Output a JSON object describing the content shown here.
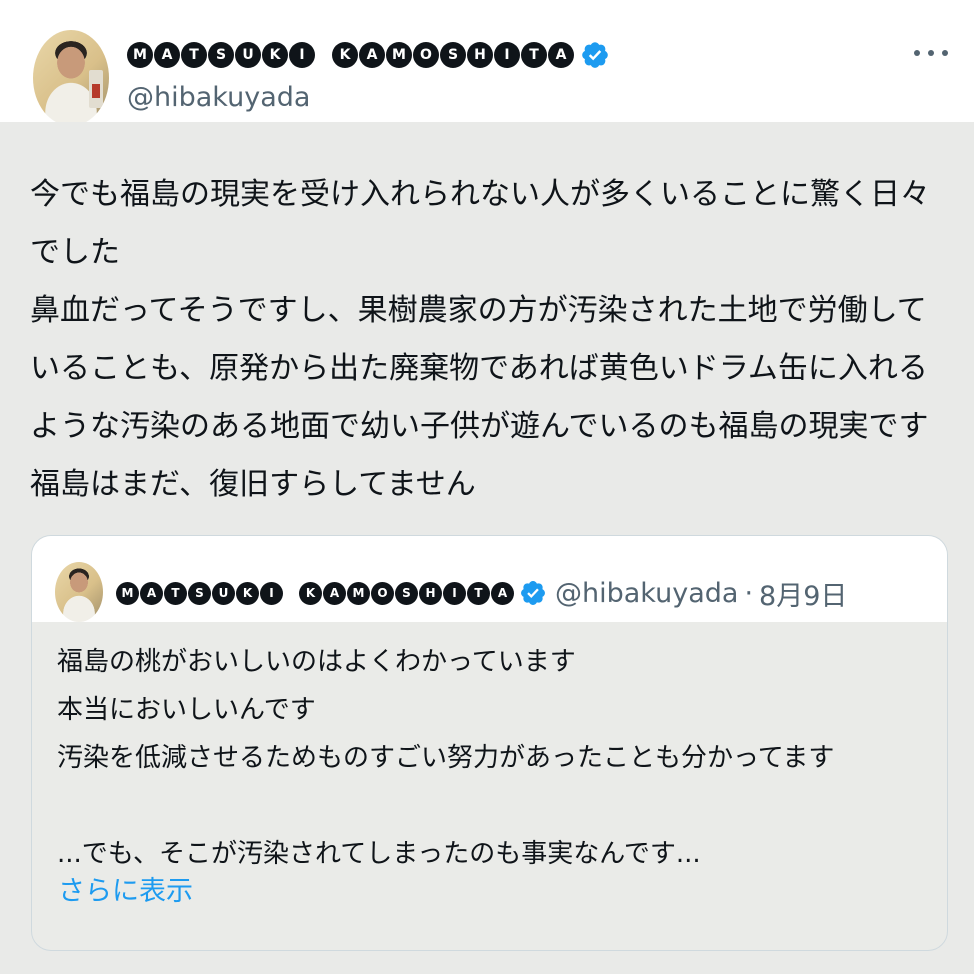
{
  "tweet": {
    "author": {
      "display_name_letters": [
        "M",
        "A",
        "T",
        "S",
        "U",
        "K",
        "I",
        "",
        "K",
        "A",
        "M",
        "O",
        "S",
        "H",
        "I",
        "T",
        "A"
      ],
      "handle": "@hibakuyada",
      "avatar_icon": "profile-photo",
      "verified_icon": "verified-badge-icon"
    },
    "more_icon": "more-options-icon",
    "text_lines": [
      "今でも福島の現実を受け入れられない人が多くいることに驚く日々",
      "でした",
      "鼻血だってそうですし、果樹農家の方が汚染された土地で労働して",
      "いることも、原発から出た廃棄物であれば黄色いドラム缶に入れる",
      "ような汚染のある地面で幼い子供が遊んでいるのも福島の現実です",
      "福島はまだ、復旧すらしてません"
    ]
  },
  "quote": {
    "author": {
      "display_name_letters": [
        "M",
        "A",
        "T",
        "S",
        "U",
        "K",
        "I",
        "",
        "K",
        "A",
        "M",
        "O",
        "S",
        "H",
        "I",
        "T",
        "A"
      ],
      "handle": "@hibakuyada",
      "separator": "·",
      "date": "8月9日"
    },
    "text_lines": [
      "福島の桃がおいしいのはよくわかっています",
      "本当においしいんです",
      "汚染を低減させるためものすごい努力があったことも分かってます",
      "",
      "...でも、そこが汚染されてしまったのも事実なんです..."
    ],
    "show_more": "さらに表示"
  },
  "colors": {
    "text": "#0f1419",
    "secondary": "#536471",
    "link": "#1d9bf0",
    "verified": "#1d9bf0",
    "content_bg": "#e9eae8"
  }
}
